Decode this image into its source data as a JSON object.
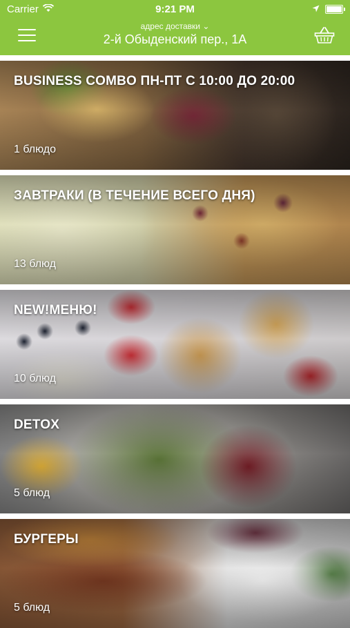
{
  "status_bar": {
    "carrier": "Carrier",
    "time": "9:21 PM"
  },
  "header": {
    "address_label": "адрес доставки ⌄",
    "address_value": "2-й Обыденский пер., 1А",
    "background_color": "#8cc63f"
  },
  "categories": [
    {
      "title": "BUSINESS COMBO ПН-ПТ С 10:00 ДО 20:00",
      "count": "1 блюдо"
    },
    {
      "title": "ЗАВТРАКИ (В ТЕЧЕНИЕ ВСЕГО ДНЯ)",
      "count": "13 блюд"
    },
    {
      "title": "NEW!МЕНЮ!",
      "count": "10 блюд"
    },
    {
      "title": "DETOX",
      "count": "5 блюд"
    },
    {
      "title": "БУРГЕРЫ",
      "count": "5 блюд"
    }
  ]
}
